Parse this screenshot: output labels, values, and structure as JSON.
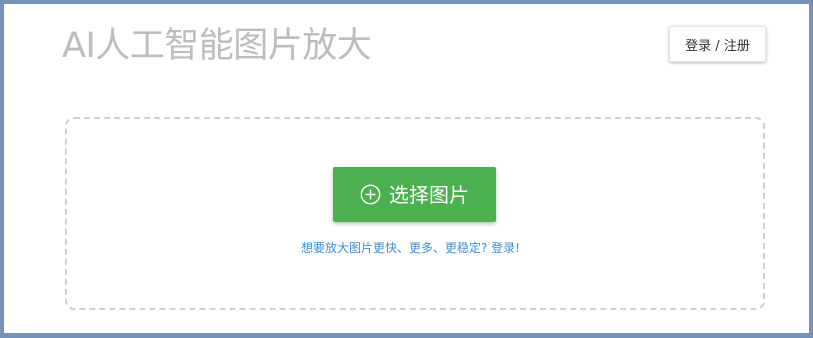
{
  "header": {
    "title": "AI人工智能图片放大",
    "login_label": "登录 / 注册"
  },
  "upload": {
    "select_label": "选择图片",
    "select_icon": "plus-circle-icon",
    "hint_text": "想要放大图片更快、更多、更稳定? 登录!"
  },
  "colors": {
    "frame_border": "#7692b6",
    "title_text": "#bdbdbd",
    "primary_button": "#4caf50",
    "link_text": "#3d8fd6",
    "dashed_border": "#cfcfcf"
  }
}
